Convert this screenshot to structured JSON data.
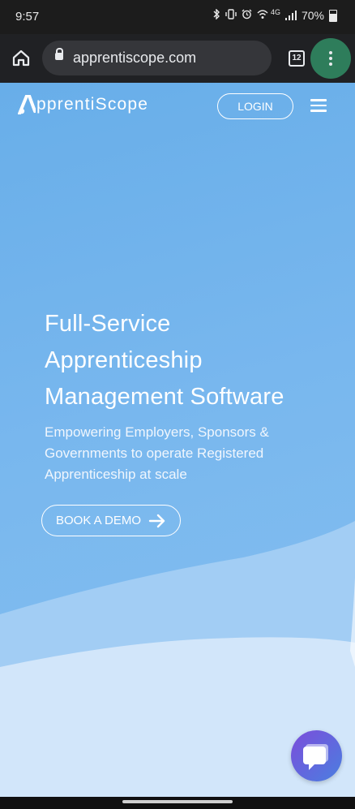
{
  "status": {
    "time": "9:57",
    "network": "4G",
    "battery": "70%",
    "icons": [
      "bluetooth-icon",
      "vibrate-icon",
      "alarm-icon",
      "wifi-icon",
      "signal-icon",
      "battery-icon"
    ]
  },
  "browser": {
    "url": "apprentiscope.com",
    "tab_count": "12",
    "icons": [
      "home-icon",
      "lock-icon",
      "tabs-icon",
      "more-vert-icon"
    ]
  },
  "site": {
    "logo_text": "pprentiScope",
    "login_label": "LOGIN",
    "hero_title_lines": [
      "Full-Service",
      "Apprenticeship",
      "Management Software"
    ],
    "hero_sub_lines": [
      "Empowering Employers, Sponsors &",
      "Governments to operate Registered",
      "Apprenticeship at scale"
    ],
    "demo_label": "BOOK A DEMO"
  },
  "colors": {
    "accent_blue": "#6eb1ea",
    "chat_gradient_start": "#7c4ddb",
    "chat_gradient_end": "#4a7fe0",
    "browser_menu_green": "#2e7d5b"
  }
}
